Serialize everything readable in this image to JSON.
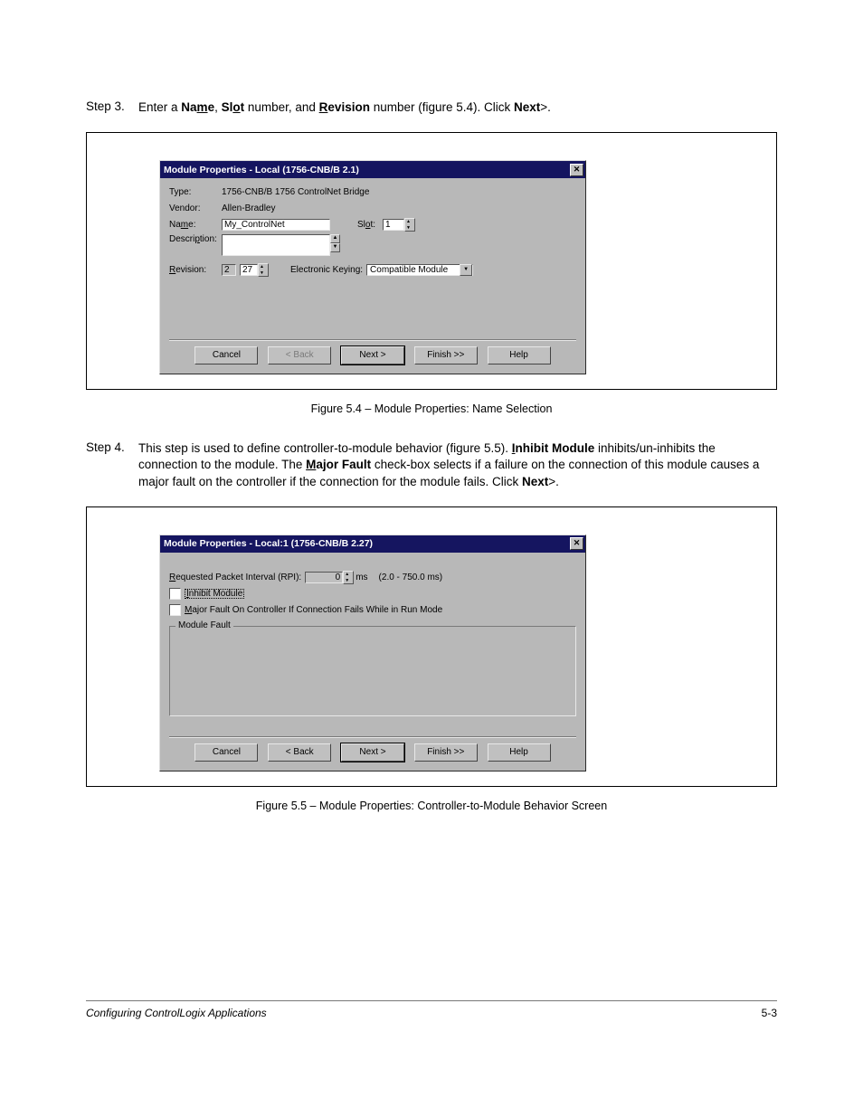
{
  "step3": {
    "label": "Step 3.",
    "text_pre": "Enter a ",
    "name_bold": "Name",
    "name_u": "m",
    "comma1": ", ",
    "slot_bold_pre": "Sl",
    "slot_bold_u": "o",
    "slot_bold_post": "t",
    "num_text": " number, and ",
    "rev_u": "R",
    "rev_rest": "evision",
    "num2": " number (figure 5.4). Click ",
    "next_bold": "Next",
    "gt": ">.",
    "dialog": {
      "title": "Module Properties - Local (1756-CNB/B 2.1)",
      "type_lbl": "Type:",
      "type_val": "1756-CNB/B 1756 ControlNet Bridge",
      "vendor_lbl": "Vendor:",
      "vendor_val": "Allen-Bradley",
      "name_lbl": "Name:",
      "name_val": "My_ControlNet",
      "slot_lbl": "Slot:",
      "slot_val": "1",
      "desc_lbl": "Description:",
      "rev_lbl": "Revision:",
      "rev_major": "2",
      "rev_minor": "27",
      "ek_lbl": "Electronic Keying:",
      "ek_val": "Compatible Module",
      "btn_cancel": "Cancel",
      "btn_back": "< Back",
      "btn_next": "Next >",
      "btn_finish": "Finish >>",
      "btn_help": "Help"
    },
    "caption": "Figure 5.4 – Module Properties: Name Selection"
  },
  "step4": {
    "label": "Step 4.",
    "l1a": "This step is used to define controller-to-module behavior (figure 5.5). ",
    "inhibit_u": "I",
    "inhibit_rest": "nhibit Module",
    "l2a": " inhibits/un-inhibits the connection to the module. The ",
    "major_u": "M",
    "major_rest": "ajor Fault",
    "l2b": " check-box selects if a failure on the connection of this module causes a major fault on the controller if the connection for the module fails. Click ",
    "next_bold": "Next",
    "gt": ">.",
    "dialog": {
      "title": "Module Properties - Local:1 (1756-CNB/B 2.27)",
      "rpi_lbl_u": "R",
      "rpi_lbl_rest": "equested Packet Interval (RPI):",
      "rpi_val": "0",
      "rpi_ms": "ms",
      "rpi_range": "(2.0 - 750.0 ms)",
      "inhibit_u": "I",
      "inhibit_rest": "nhibit Module",
      "major_u": "M",
      "major_rest": "ajor Fault On Controller If Connection Fails While in Run Mode",
      "fieldset": "Module Fault",
      "btn_cancel": "Cancel",
      "btn_back": "< Back",
      "btn_next": "Next >",
      "btn_finish": "Finish >>",
      "btn_help": "Help"
    },
    "caption": "Figure 5.5 – Module Properties: Controller-to-Module Behavior Screen"
  },
  "footer": {
    "left": "Configuring ControlLogix Applications",
    "right": "5-3"
  }
}
